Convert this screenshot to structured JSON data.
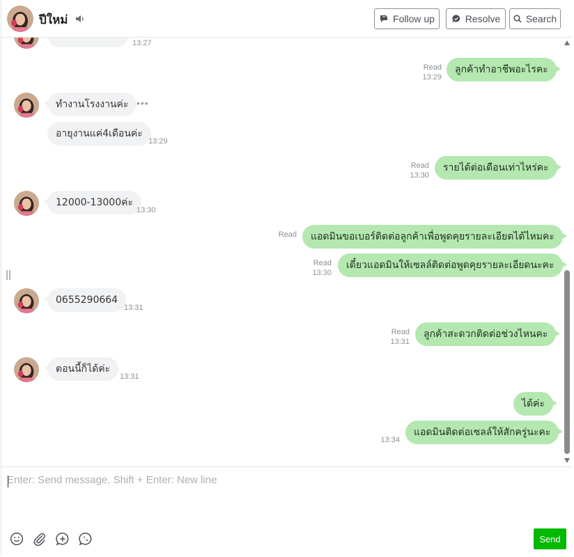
{
  "header": {
    "room_name": "ปีใหม่",
    "buttons": {
      "follow_up": "Follow up",
      "resolve": "Resolve",
      "search": "Search"
    }
  },
  "messages": {
    "m0": {
      "time": "13:27"
    },
    "m1": {
      "status": "Read",
      "time": "13:29",
      "text": "ลูกค้าทำอาชีพอะไรคะ"
    },
    "m2": {
      "text": "ทำงานโรงงานค่ะ"
    },
    "m3": {
      "text": "อายุงานแค่4เดือนค่ะ",
      "time": "13:29"
    },
    "m4": {
      "status": "Read",
      "time": "13:30",
      "text": "รายได้ต่อเดือนเท่าไหร่คะ"
    },
    "m5": {
      "text": "12000-13000ค่ะ",
      "time": "13:30"
    },
    "m6": {
      "status": "Read",
      "text": "แอดมินขอเบอร์ติดต่อลูกค้าเพื่อพูดคุยรายละเอียดได้ไหมคะ"
    },
    "m7": {
      "status": "Read",
      "time": "13:30",
      "text": "เดี๋ยวแอดมินให้เซลล์ติดต่อพูดคุยรายละเอียดนะคะ"
    },
    "m8": {
      "text": "0655290664",
      "time": "13:31"
    },
    "m9": {
      "status": "Read",
      "time": "13:31",
      "text": "ลูกค้าสะดวกติดต่อช่วงไหนคะ"
    },
    "m10": {
      "text": "ตอนนี้ก็ได้ค่ะ",
      "time": "13:31"
    },
    "m11": {
      "text": "ได้ค่ะ"
    },
    "m12": {
      "time": "13:34",
      "text": "แอดมินติดต่อเซลล์ให้สักครู่นะคะ"
    }
  },
  "composer": {
    "placeholder": "Enter: Send message, Shift + Enter: New line",
    "send_label": "Send"
  },
  "colors": {
    "outgoing_bubble": "#b4e8b0",
    "incoming_bubble": "#f1f2f4",
    "send_button": "#00b900"
  }
}
